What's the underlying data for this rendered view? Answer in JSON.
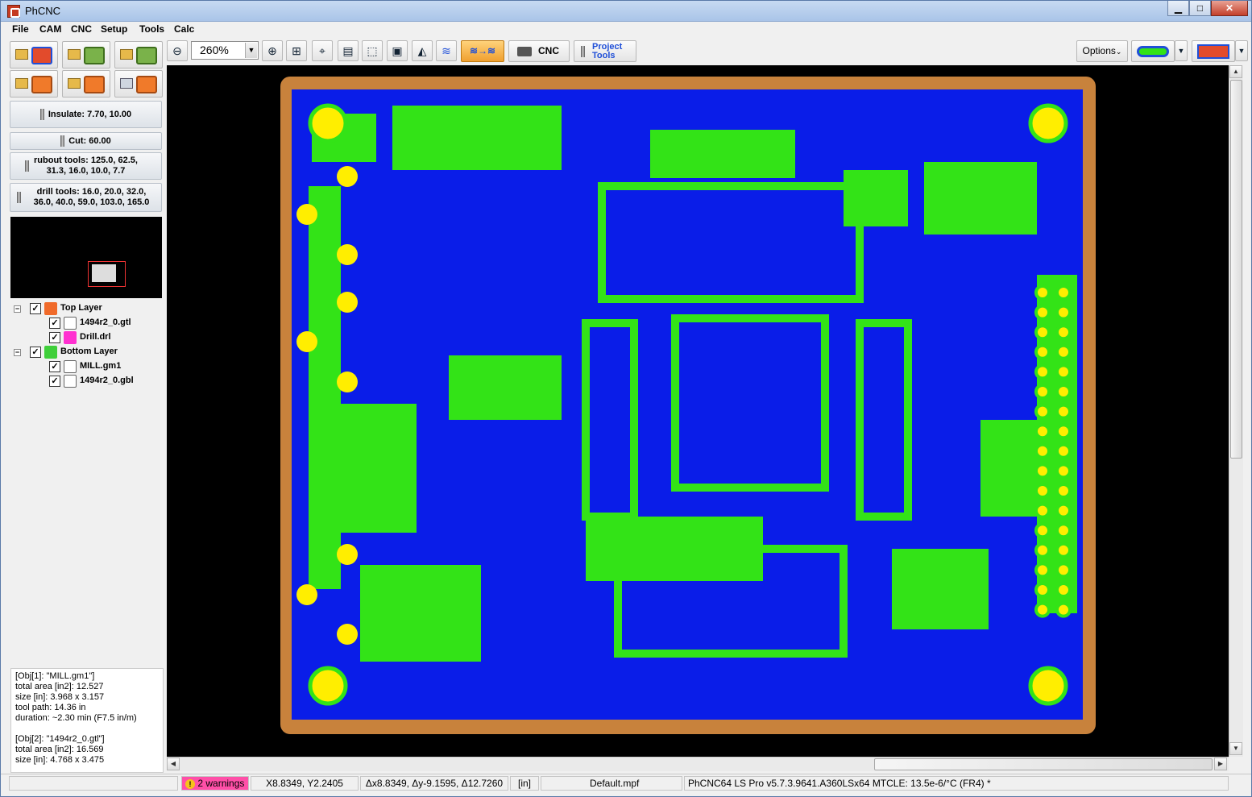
{
  "app": {
    "title": "PhCNC"
  },
  "window_controls": {
    "minimize": "▁",
    "maximize": "□",
    "close": "✕"
  },
  "menu": [
    "File",
    "CAM",
    "CNC",
    "Setup",
    "Tools",
    "Calc"
  ],
  "tools": {
    "insulate": "Insulate:  7.70, 10.00",
    "cut": "Cut: 60.00",
    "rubout_line1": "rubout tools: 125.0, 62.5,",
    "rubout_line2": "31.3, 16.0, 10.0, 7.7",
    "drill_line1": "drill tools: 16.0, 20.0, 32.0,",
    "drill_line2": "36.0, 40.0, 59.0, 103.0, 165.0"
  },
  "layers": {
    "top_layer": "Top Layer",
    "top_gtl": "1494r2_0.gtl",
    "drill": "Drill.drl",
    "bottom_layer": "Bottom Layer",
    "mill": "MILL.gm1",
    "bottom_gbl": "1494r2_0.gbl"
  },
  "info_lines": [
    "[Obj[1]: \"MILL.gm1\"]",
    "total area [in2]: 12.527",
    "size [in]: 3.968 x 3.157",
    "tool path: 14.36 in",
    "duration: ~2.30 min (F7.5 in/m)",
    "",
    "[Obj[2]: \"1494r2_0.gtl\"]",
    "total area [in2]: 16.569",
    "size [in]: 4.768 x 3.475"
  ],
  "toolbar": {
    "zoom_value": "260%",
    "cnc_label": "CNC",
    "project_tools_line1": "Project",
    "project_tools_line2": "Tools",
    "options_label": "Options"
  },
  "status": {
    "warnings": "2 warnings",
    "coords": "X8.8349, Y2.2405",
    "delta": "Δx8.8349, Δy-9.1595, Δ12.7260",
    "units": "[in]",
    "profile": "Default.mpf",
    "version": "PhCNC64 LS Pro v5.7.3.9641.A360LSx64 MTCLE: 13.5e-6/°C (FR4) *"
  },
  "colors": {
    "board_outline": "#c8823c",
    "board_fill": "#0a1de8",
    "copper": "#33e317",
    "pad": "#ffee00",
    "trace": "#2a6dff",
    "warning": "#ff4fa8"
  }
}
